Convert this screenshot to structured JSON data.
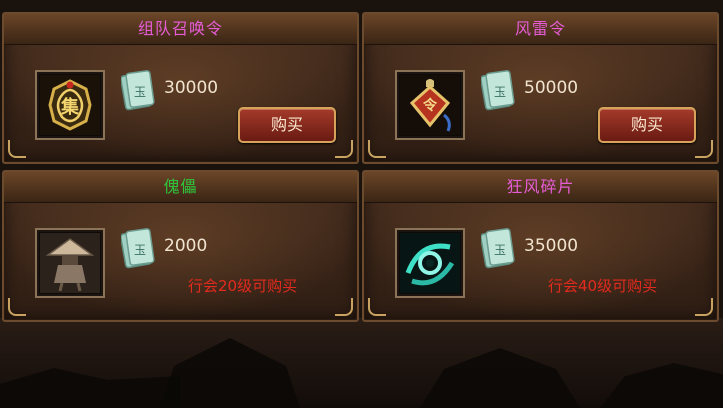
{
  "colors": {
    "title_magenta": "#e65cd6",
    "title_green": "#2fc33b",
    "price_text": "#f0e3cf",
    "requirement_red": "#e22a1e",
    "button_red": "#a43a2a"
  },
  "shop_items": [
    {
      "name": "组队召唤令",
      "title_color": "#e65cd6",
      "icon": "team-summon-token-icon",
      "currency_icon": "jade-coupon-icon",
      "price": "30000",
      "buy_label": "购买"
    },
    {
      "name": "风雷令",
      "title_color": "#e65cd6",
      "icon": "wind-thunder-token-icon",
      "currency_icon": "jade-coupon-icon",
      "price": "50000",
      "buy_label": "购买"
    },
    {
      "name": "傀儡",
      "title_color": "#2fc33b",
      "icon": "puppet-icon",
      "currency_icon": "jade-coupon-icon",
      "price": "2000",
      "requirement": "行会20级可购买"
    },
    {
      "name": "狂风碎片",
      "title_color": "#e65cd6",
      "icon": "gale-fragment-icon",
      "currency_icon": "jade-coupon-icon",
      "price": "35000",
      "requirement": "行会40级可购买"
    }
  ]
}
